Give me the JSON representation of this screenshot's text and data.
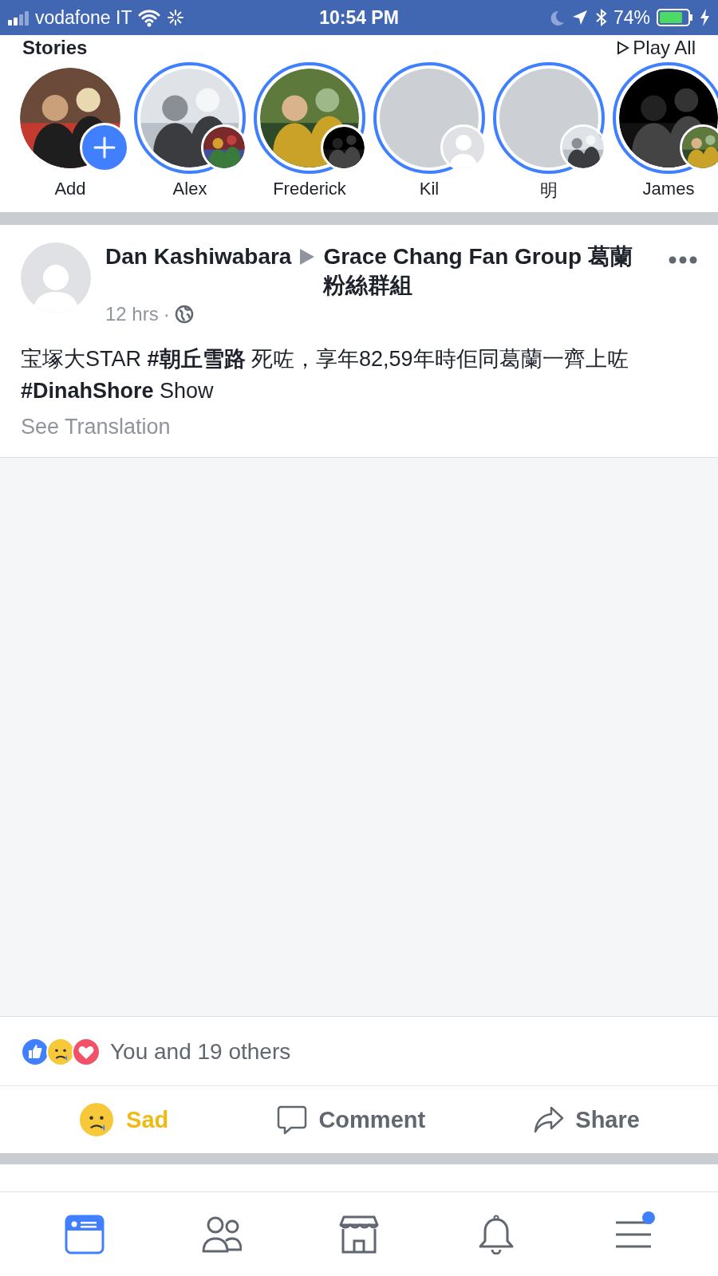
{
  "status_bar": {
    "carrier": "vodafone IT",
    "time": "10:54 PM",
    "battery": "74%"
  },
  "stories": {
    "title": "Stories",
    "play_all": "Play All",
    "items": [
      {
        "label": "Add",
        "kind": "add",
        "ring": false
      },
      {
        "label": "Alex",
        "ring": true
      },
      {
        "label": "Frederick",
        "ring": true
      },
      {
        "label": "Kil",
        "kind": "silhouette",
        "ring": true
      },
      {
        "label": "明",
        "kind": "blank",
        "ring": true
      },
      {
        "label": "James",
        "ring": true
      }
    ]
  },
  "post": {
    "author": "Dan Kashiwabara",
    "group": "Grace Chang Fan Group 葛蘭粉絲群組",
    "time": "12 hrs",
    "separator": "·",
    "text": "宝塚大STAR **#朝丘雪路** 死咗，享年82,59年時佢同葛蘭一齊上咗 **#DinahShore** Show",
    "translation": "See Translation",
    "reactions": {
      "summary": "You and 19 others"
    },
    "actions": [
      {
        "kind": "reaction",
        "label": "Sad",
        "selected": true
      },
      {
        "kind": "comment",
        "label": "Comment",
        "selected": false
      },
      {
        "kind": "share",
        "label": "Share",
        "selected": false
      }
    ]
  },
  "tab_bar": [
    {
      "kind": "feed",
      "selected": true,
      "badge": false
    },
    {
      "kind": "friends",
      "selected": false,
      "badge": false
    },
    {
      "kind": "marketplace",
      "selected": false,
      "badge": false
    },
    {
      "kind": "notifications",
      "selected": false,
      "badge": false
    },
    {
      "kind": "menu",
      "selected": false,
      "badge": true
    }
  ]
}
